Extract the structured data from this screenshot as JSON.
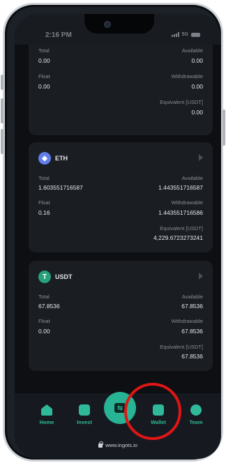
{
  "status_bar": {
    "time": "2:16 PM",
    "network": "5G"
  },
  "cards": [
    {
      "total_label": "Total",
      "total_value": "0.00",
      "available_label": "Available",
      "available_value": "0.00",
      "float_label": "Float",
      "float_value": "0.00",
      "withdrawable_label": "Withdrawable",
      "withdrawable_value": "0.00",
      "equivalent_label": "Equivalent [USDT]",
      "equivalent_value": "0.00"
    },
    {
      "coin": "ETH",
      "icon": "ethereum-icon",
      "color": "#627eea",
      "total_label": "Total",
      "total_value": "1.603551716587",
      "available_label": "Available",
      "available_value": "1.443551716587",
      "float_label": "Float",
      "float_value": "0.16",
      "withdrawable_label": "Withdrawable",
      "withdrawable_value": "1.443551716586",
      "equivalent_label": "Equivalent [USDT]",
      "equivalent_value": "4,229.6723273241"
    },
    {
      "coin": "USDT",
      "icon": "tether-icon",
      "color": "#26a17b",
      "total_label": "Total",
      "total_value": "67.8536",
      "available_label": "Available",
      "available_value": "67.8536",
      "float_label": "Float",
      "float_value": "0.00",
      "withdrawable_label": "Withdrawable",
      "withdrawable_value": "67.8536",
      "equivalent_label": "Equivalent [USDT]",
      "equivalent_value": "67.8536"
    }
  ],
  "nav": {
    "items": [
      {
        "label": "Home",
        "icon": "home-icon"
      },
      {
        "label": "Invest",
        "icon": "chart-icon"
      },
      {
        "label": "Wallet",
        "icon": "wallet-icon"
      },
      {
        "label": "Team",
        "icon": "gear-icon"
      }
    ],
    "center_icon": "swap-icon",
    "accent_color": "#2fb99a"
  },
  "browser": {
    "url": "www.ingots.io"
  },
  "highlight_color": "#e01515"
}
